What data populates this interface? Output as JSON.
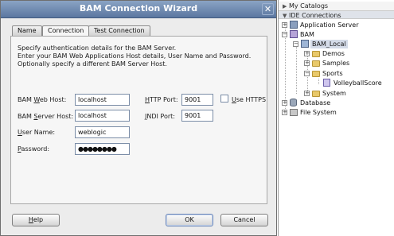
{
  "dialog": {
    "title": "BAM Connection Wizard",
    "close_glyph": "✕",
    "tabs": [
      {
        "label": "Name",
        "active": false
      },
      {
        "label": "Connection",
        "active": true
      },
      {
        "label": "Test Connection",
        "active": false
      }
    ],
    "intro_lines": [
      "Specify authentication details for the BAM Server.",
      "Enter your BAM Web Applications Host details, User Name and Password.",
      "Optionally specify a different BAM Server Host."
    ],
    "fields": {
      "web_host": {
        "label_pre": "BAM ",
        "label_mn": "W",
        "label_post": "eb Host:",
        "value": "localhost"
      },
      "server_host": {
        "label_pre": "BAM ",
        "label_mn": "S",
        "label_post": "erver Host:",
        "value": "localhost"
      },
      "user_name": {
        "label_pre": "",
        "label_mn": "U",
        "label_post": "ser Name:",
        "value": "weblogic"
      },
      "password": {
        "label_pre": "",
        "label_mn": "P",
        "label_post": "assword:",
        "value": "●●●●●●●●"
      },
      "http_port": {
        "label_pre": "",
        "label_mn": "H",
        "label_post": "TTP Port:",
        "value": "9001"
      },
      "jndi_port": {
        "label_pre": "",
        "label_mn": "J",
        "label_post": "NDI Port:",
        "value": "9001"
      }
    },
    "use_https": {
      "label_pre": "",
      "label_mn": "U",
      "label_post": "se HTTPS",
      "checked": false
    },
    "buttons": {
      "help_mn": "H",
      "help_rest": "elp",
      "ok": "OK",
      "cancel": "Cancel"
    }
  },
  "resource_palette": {
    "my_catalogs": "My Catalogs",
    "ide_connections": "IDE Connections",
    "tree": {
      "application_server": "Application Server",
      "bam": "BAM",
      "bam_local": "BAM_Local",
      "demos": "Demos",
      "samples": "Samples",
      "sports": "Sports",
      "volleyball_score": "VolleyballScore",
      "system": "System",
      "database": "Database",
      "file_system": "File System"
    }
  }
}
